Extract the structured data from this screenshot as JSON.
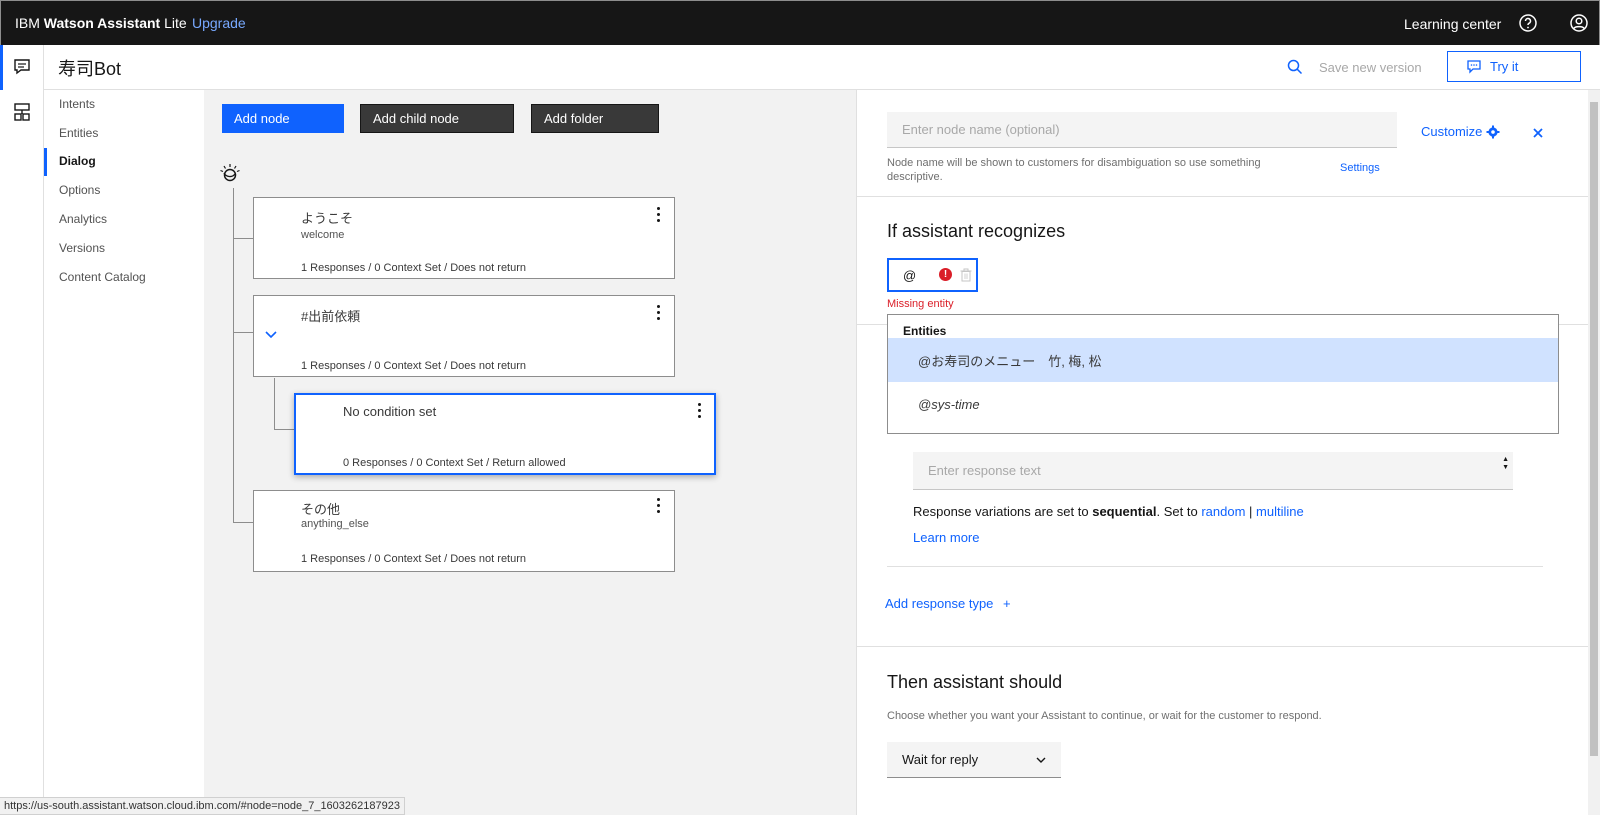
{
  "topbar": {
    "brand_prefix": "IBM ",
    "brand_bold": "Watson Assistant",
    "brand_suffix": " Lite",
    "upgrade": "Upgrade",
    "learning_center": "Learning center",
    "help_icon": "help-icon",
    "user_icon": "user-avatar-icon"
  },
  "rail": {
    "items": [
      {
        "icon": "chat-icon"
      },
      {
        "icon": "skills-icon"
      }
    ]
  },
  "header": {
    "title": "寿司Bot",
    "save_version": "Save new version",
    "try_it": "Try it"
  },
  "nav": {
    "items": [
      {
        "label": "Intents"
      },
      {
        "label": "Entities"
      },
      {
        "label": "Dialog"
      },
      {
        "label": "Options"
      },
      {
        "label": "Analytics"
      },
      {
        "label": "Versions"
      },
      {
        "label": "Content Catalog"
      }
    ],
    "active": "Dialog"
  },
  "canvas": {
    "add_node": "Add node",
    "add_child_node": "Add child node",
    "add_folder": "Add folder",
    "nodes": [
      {
        "title": "ようこそ",
        "condition": "welcome",
        "meta": "1 Responses / 0 Context Set / Does not return"
      },
      {
        "title": "#出前依頼",
        "condition": "",
        "meta": "1 Responses / 0 Context Set / Does not return"
      },
      {
        "title": "No condition set",
        "condition": "",
        "meta": "0 Responses / 0 Context Set / Return allowed"
      },
      {
        "title": "その他",
        "condition": "anything_else",
        "meta": "1 Responses / 0 Context Set / Does not return"
      }
    ]
  },
  "editor": {
    "node_name_placeholder": "Enter node name (optional)",
    "customize": "Customize",
    "helper": "Node name will be shown to customers for disambiguation so use something descriptive.",
    "settings": "Settings",
    "if_title": "If assistant recognizes",
    "condition_value": "@",
    "missing_entity": "Missing entity",
    "dropdown": {
      "heading": "Entities",
      "items": [
        "@お寿司のメニュー　竹, 梅, 松",
        "@sys-time"
      ]
    },
    "response_placeholder": "Enter response text",
    "variations_prefix": "Response variations are set to ",
    "variations_mode": "sequential",
    "variations_mid": ". Set to ",
    "variations_random": "random",
    "variations_sep": " | ",
    "variations_multiline": "multiline",
    "learn_more": "Learn more",
    "add_response_type": "Add response type",
    "add_response_plus": "+",
    "then_title": "Then assistant should",
    "then_desc": "Choose whether you want your Assistant to continue, or wait for the customer to respond.",
    "then_select": "Wait for reply"
  },
  "statusbar": {
    "url": "https://us-south.assistant.watson.cloud.ibm.com/#node=node_7_1603262187923"
  },
  "colors": {
    "accent": "#0f62fe",
    "topbar": "#161616",
    "error": "#da1e28",
    "highlight": "#d0e2ff"
  }
}
